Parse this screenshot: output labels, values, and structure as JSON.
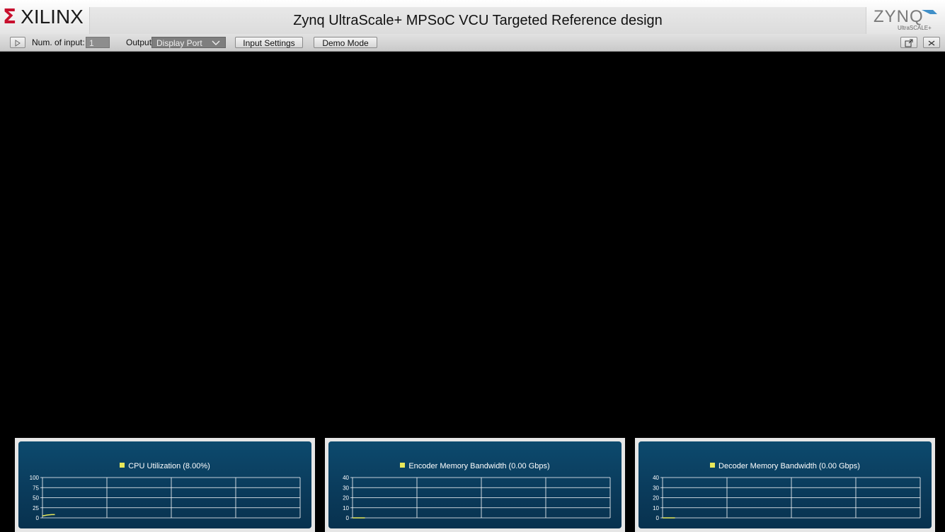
{
  "header": {
    "left_logo": "XILINX",
    "title": "Zynq UltraScale+ MPSoC VCU Targeted Reference design",
    "right_logo": "ZYNQ",
    "right_logo_sub": "UltraSCALE+"
  },
  "toolbar": {
    "num_input_label": "Num. of input:",
    "num_input_value": "1",
    "output_label": "Output:",
    "output_value": "Display Port",
    "input_settings_label": "Input Settings",
    "demo_mode_label": "Demo Mode"
  },
  "charts": [
    {
      "legend": "CPU Utilization (8.00%)",
      "yticks": [
        "100",
        "75",
        "50",
        "25",
        "0"
      ],
      "ymax": 100,
      "series": [
        [
          0,
          5
        ],
        [
          0.6,
          7
        ],
        [
          1.2,
          8
        ],
        [
          1.6,
          8
        ]
      ]
    },
    {
      "legend": "Encoder Memory Bandwidth (0.00 Gbps)",
      "yticks": [
        "40",
        "30",
        "20",
        "10",
        "0"
      ],
      "ymax": 40,
      "series": [
        [
          0,
          0
        ],
        [
          1.6,
          0
        ]
      ]
    },
    {
      "legend": "Decoder Memory Bandwidth (0.00 Gbps)",
      "yticks": [
        "40",
        "30",
        "20",
        "10",
        "0"
      ],
      "ymax": 40,
      "series": [
        [
          0,
          0
        ],
        [
          1.6,
          0
        ]
      ]
    }
  ],
  "colors": {
    "series": "#e8e85a",
    "chart_bg": "#0b3f62",
    "grid": "#ffffff"
  }
}
